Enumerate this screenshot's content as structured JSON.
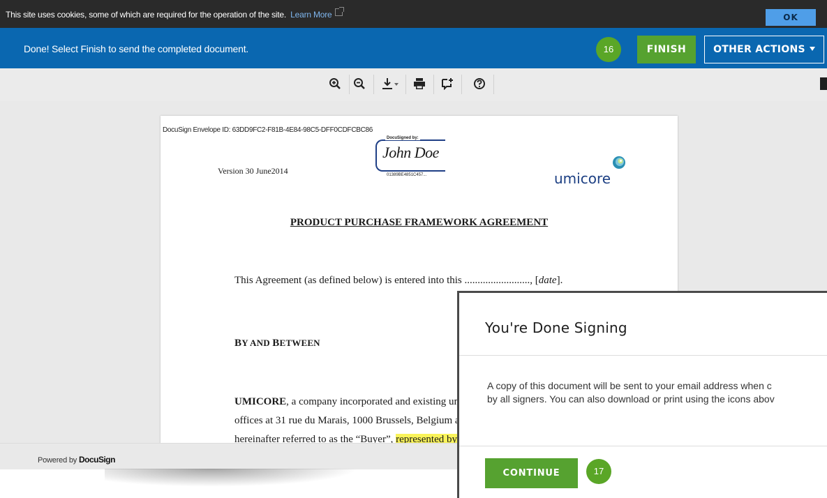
{
  "cookie_bar": {
    "text": "This site uses cookies, some of which are required for the operation of the site.",
    "link": "Learn More",
    "ok_label": "OK"
  },
  "action_bar": {
    "message": "Done! Select Finish to send the completed document.",
    "step_badge": "16",
    "finish_label": "FINISH",
    "other_actions_label": "OTHER ACTIONS"
  },
  "toolbar": {
    "icons": [
      "zoom-in-icon",
      "zoom-out-icon",
      "download-icon",
      "print-icon",
      "comment-icon",
      "help-icon"
    ]
  },
  "document": {
    "envelope_id": "DocuSign Envelope ID: 63DD9FC2-F81B-4E84-98C5-DFF0CDFCBC86",
    "version": "Version 30 June2014",
    "signature_label": "DocuSigned by:",
    "signature_name": "John Doe",
    "signature_hash": "01389BE4851C457...",
    "logo_text": "umicore",
    "title": "PRODUCT PURCHASE FRAMEWORK AGREEMENT",
    "para1_text": "This Agreement (as defined below) is entered into this ........................., [",
    "para1_date": "date",
    "para1_end": "].",
    "by_and_between_first": "B",
    "by_and_between_rest": "Y AND ",
    "by_and_between_b": "B",
    "by_and_between_end": "ETWEEN",
    "para3_bold": "UMICORE",
    "para3_line1": ", a company incorporated and existing un",
    "para3_line2": "offices at 31 rue du Marais, 1000 Brussels, Belgium a",
    "para3_line3": "hereinafter referred to as the “Buyer”,",
    "para3_highlight": "represented by"
  },
  "footer": {
    "powered_by": "Powered by",
    "brand": "DocuSign"
  },
  "modal": {
    "title": "You're Done Signing",
    "body_line1": "A copy of this document will be sent to your email address when c",
    "body_line2": "by all signers. You can also download or print using the icons abov",
    "continue_label": "CONTINUE",
    "step_badge": "17"
  },
  "colors": {
    "cookie_bar": "#2a2a2a",
    "action_bar": "#0a67b0",
    "button_green": "#56a230",
    "badge_green": "#5aa627",
    "ok_blue": "#4f9ee8",
    "highlight": "#f9f35a"
  }
}
